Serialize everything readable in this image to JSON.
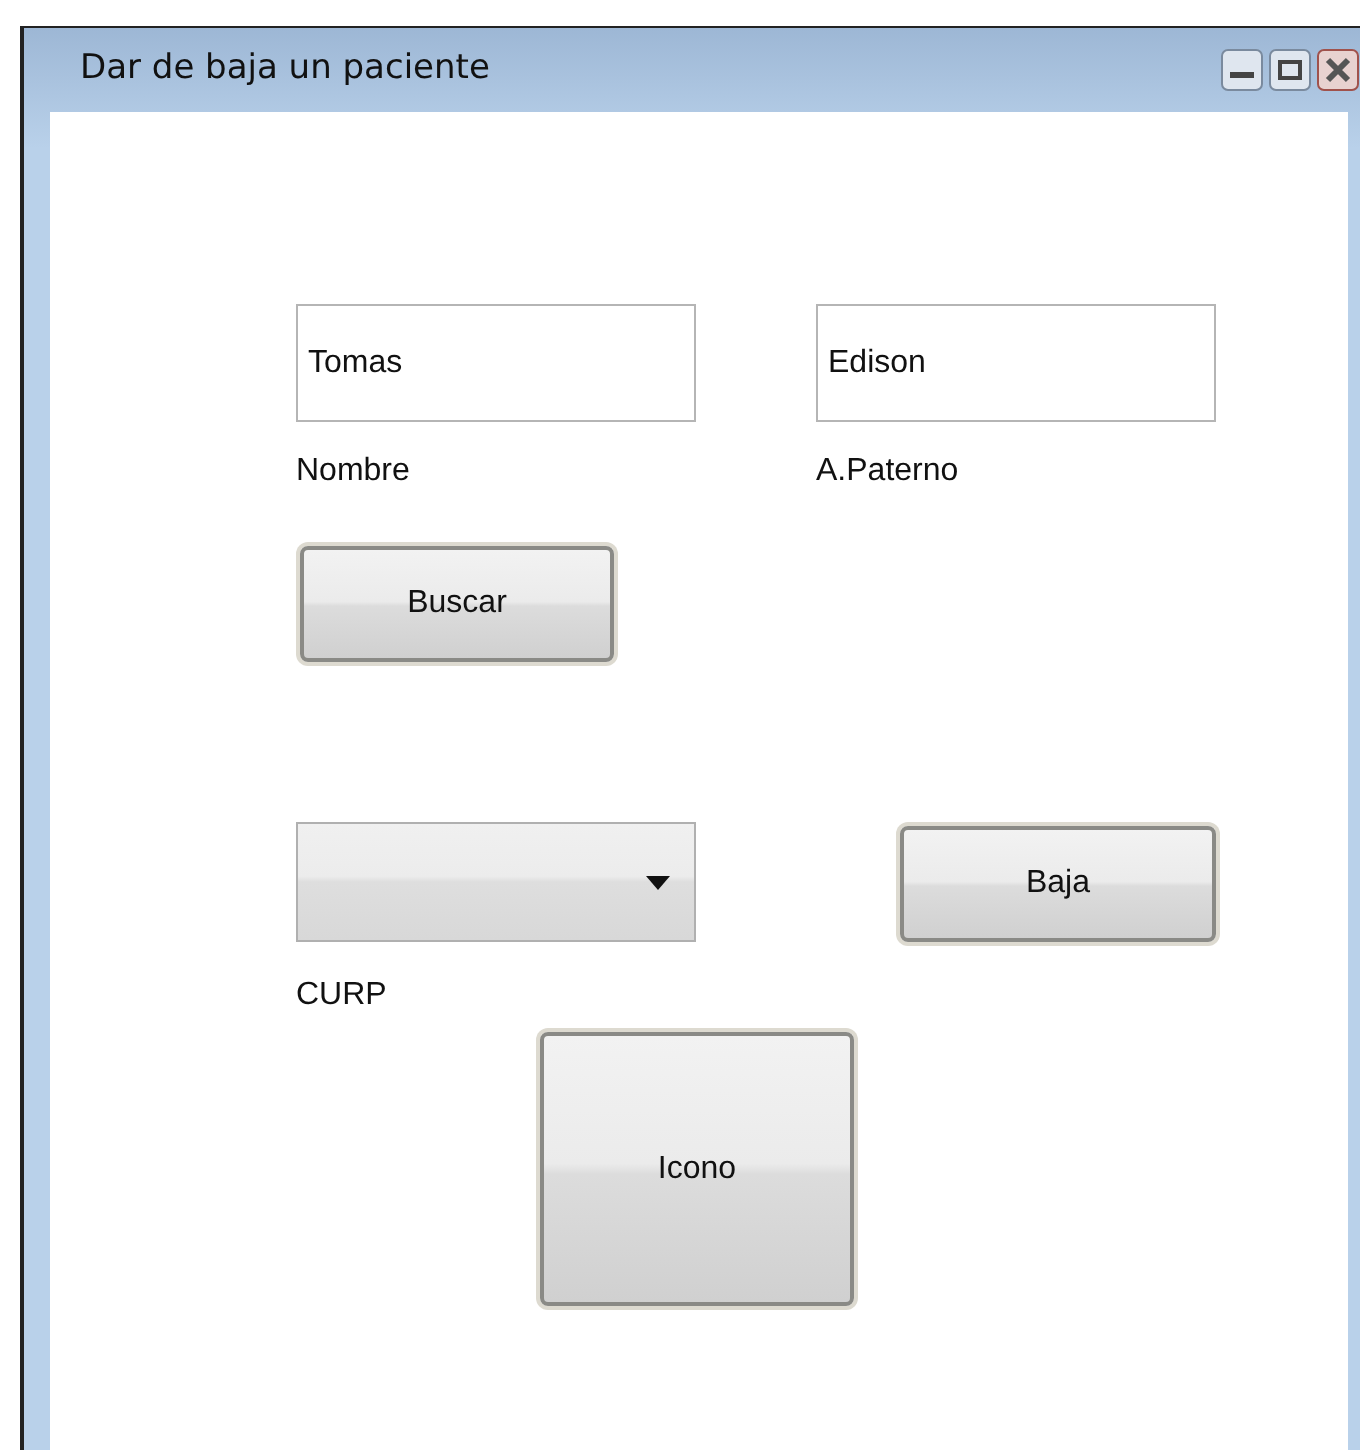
{
  "window": {
    "title": "Dar de baja un paciente"
  },
  "name_fields": [
    {
      "value": "Tomas",
      "label": "Nombre"
    },
    {
      "value": "Edison",
      "label": "A.Paterno"
    }
  ],
  "search_button": "Buscar",
  "curp": {
    "label": "CURP"
  },
  "remove_button": "Baja",
  "icon_button": "Icono"
}
